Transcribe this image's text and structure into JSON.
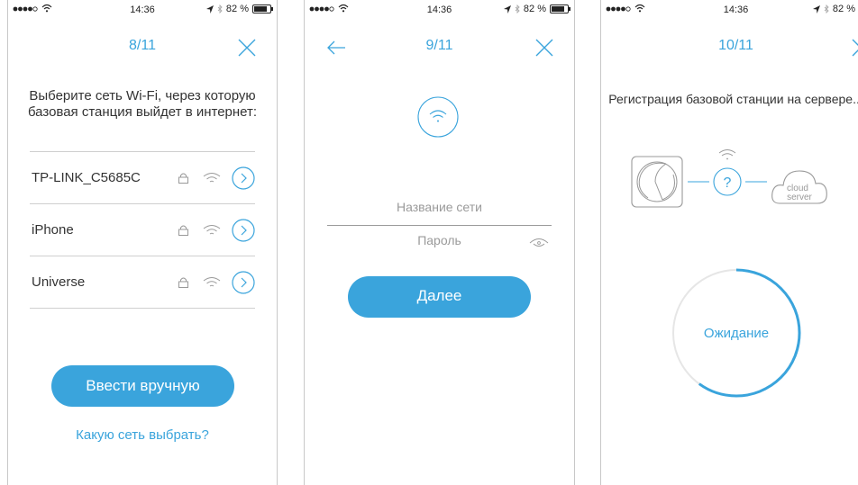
{
  "status_bar": {
    "time": "14:36",
    "battery": "82 %",
    "battery_level": 0.82
  },
  "screen1": {
    "step": "8/11",
    "prompt": "Выберите сеть Wi-Fi, через которую базовая станция выйдет в интернет:",
    "networks": [
      {
        "name": "TP-LINK_C5685C"
      },
      {
        "name": "iPhone"
      },
      {
        "name": "Universe"
      }
    ],
    "manual_button": "Ввести вручную",
    "help_link": "Какую сеть выбрать?"
  },
  "screen2": {
    "step": "9/11",
    "network_name_placeholder": "Название сети",
    "password_placeholder": "Пароль",
    "next_button": "Далее"
  },
  "screen3": {
    "step": "10/11",
    "title": "Регистрация базовой станции на сервере...",
    "unknown_symbol": "?",
    "cloud_line1": "cloud",
    "cloud_line2": "server",
    "waiting": "Ожидание",
    "progress": 0.6
  },
  "colors": {
    "accent": "#3aa4dc",
    "text": "#333333",
    "divider": "#cfcfcf",
    "muted": "#9a9a9a"
  },
  "icons": [
    "close-icon",
    "back-icon",
    "lock-icon",
    "wifi-icon",
    "chevron-right-icon",
    "eye-icon",
    "base-station-icon",
    "cloud-icon"
  ]
}
